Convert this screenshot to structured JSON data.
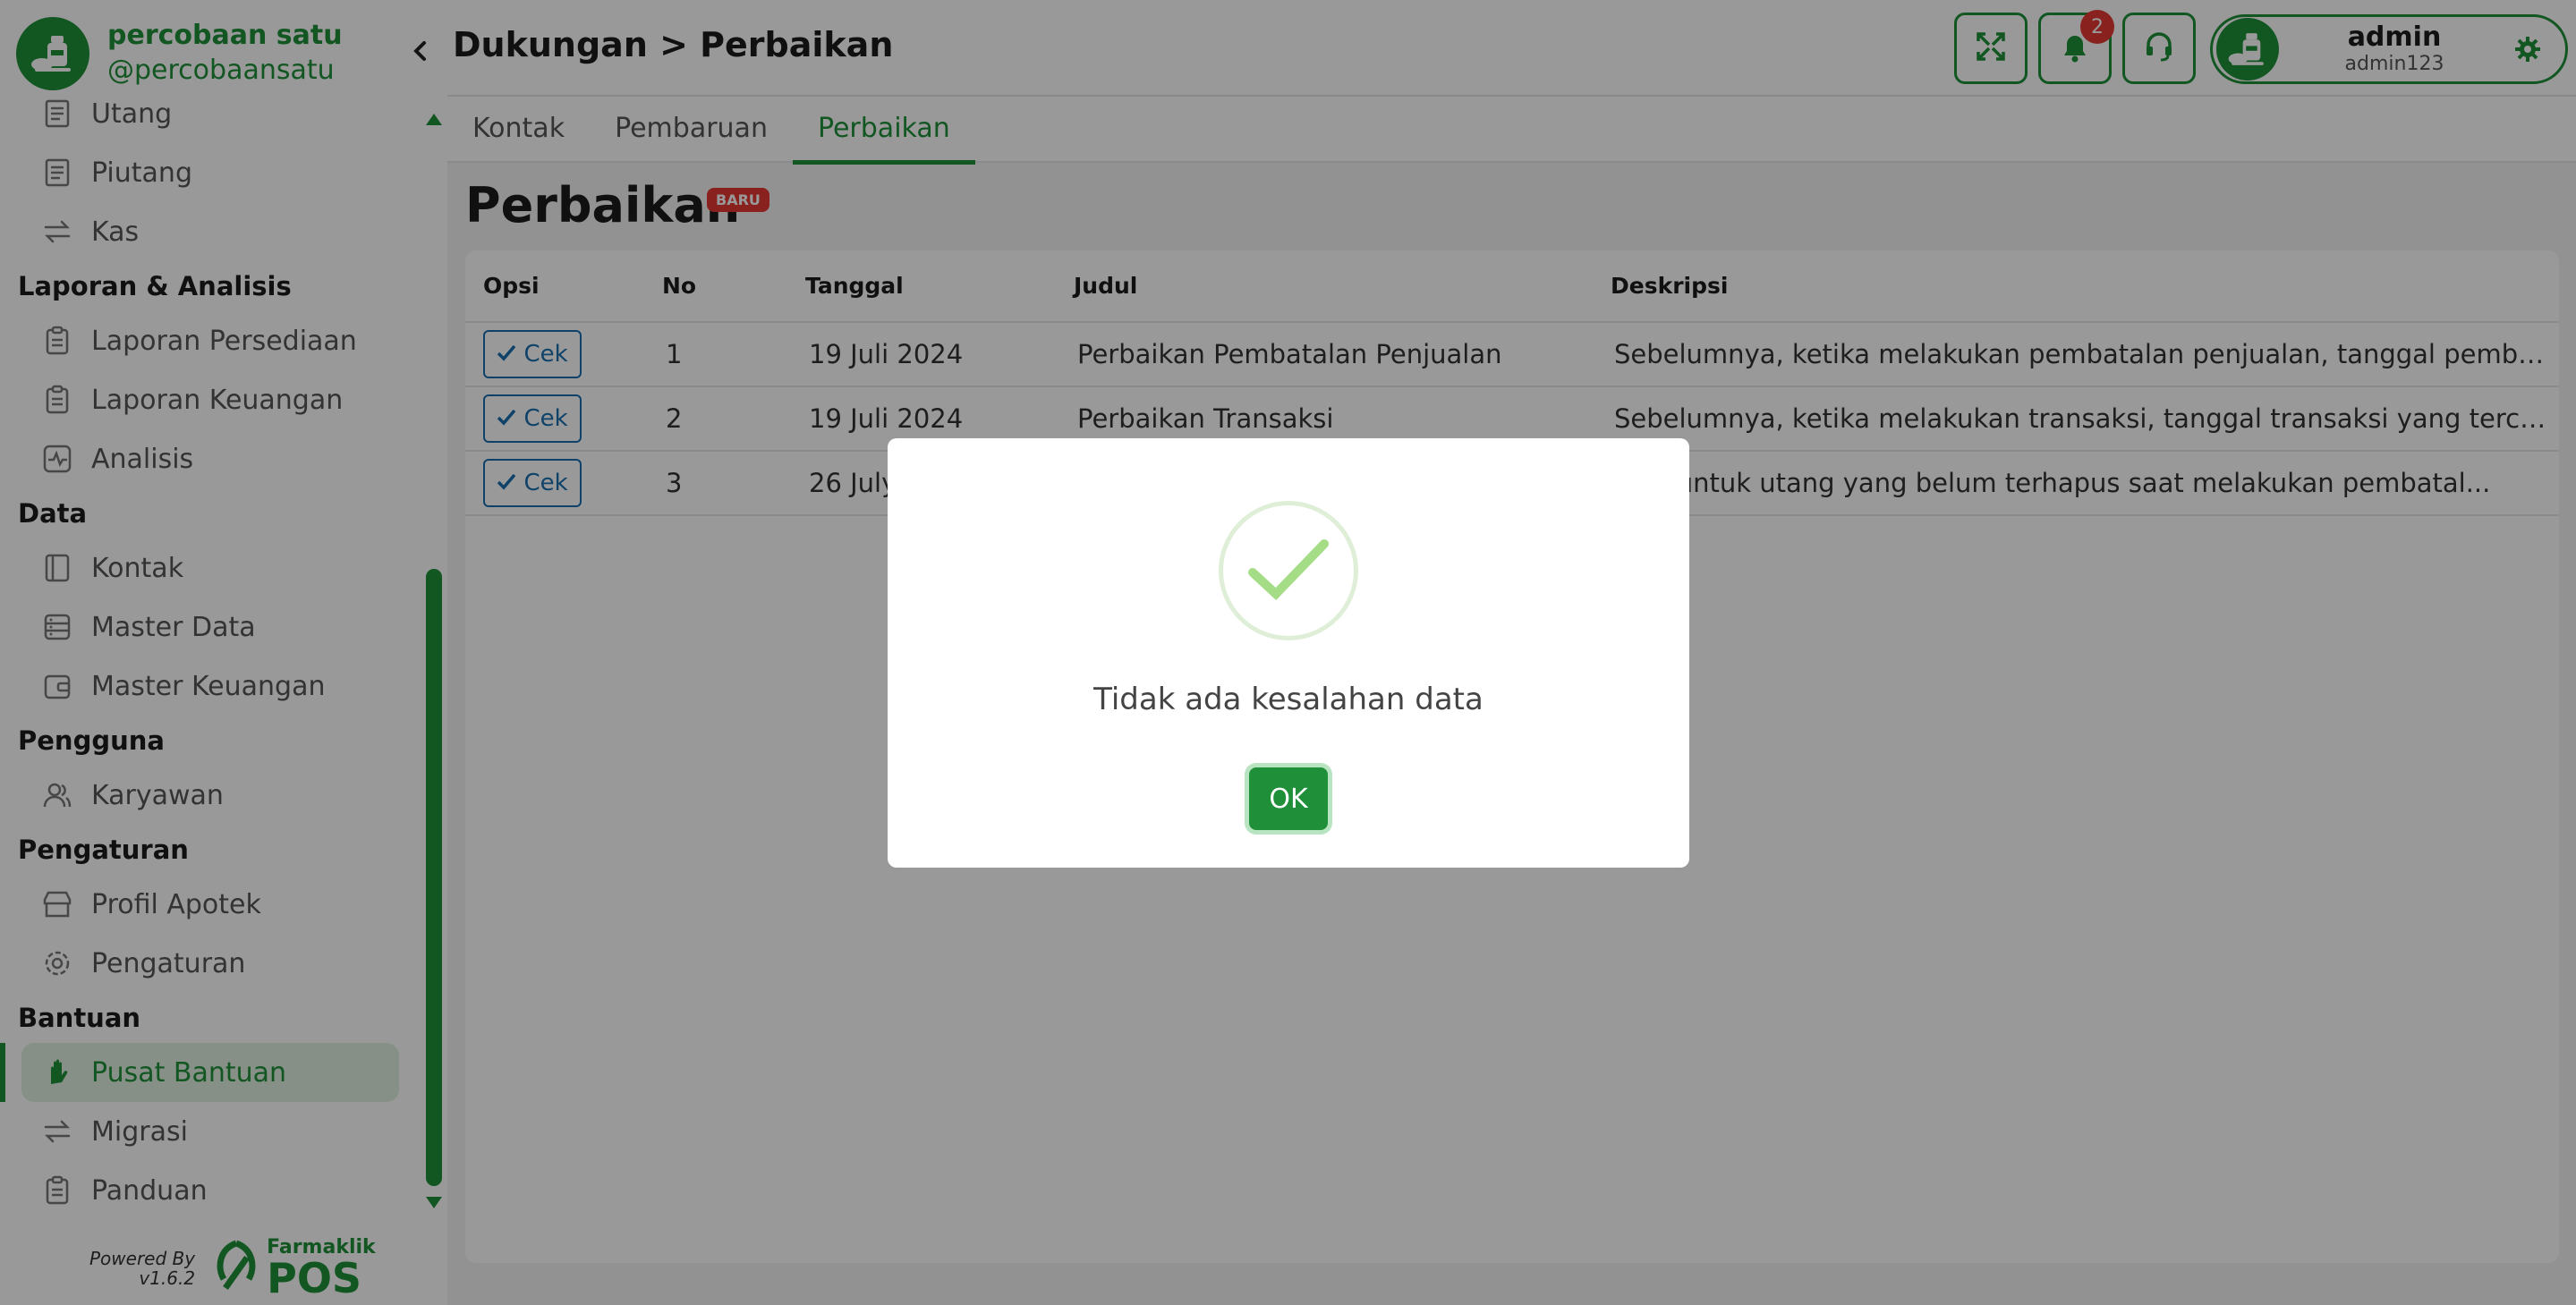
{
  "brand": {
    "name": "percobaan satu",
    "handle": "@percobaansatu"
  },
  "header": {
    "breadcrumb": "Dukungan > Perbaikan",
    "notification_count": "2"
  },
  "user": {
    "name": "admin",
    "id": "admin123"
  },
  "tabs": [
    {
      "label": "Kontak"
    },
    {
      "label": "Pembaruan"
    },
    {
      "label": "Perbaikan"
    }
  ],
  "sidebar": {
    "items_top": [
      {
        "label": "Utang",
        "icon": "receipt-icon"
      },
      {
        "label": "Piutang",
        "icon": "receipt-icon"
      },
      {
        "label": "Kas",
        "icon": "transfer-icon"
      }
    ],
    "sections": [
      {
        "title": "Laporan & Analisis",
        "items": [
          {
            "label": "Laporan Persediaan",
            "icon": "clipboard-icon"
          },
          {
            "label": "Laporan Keuangan",
            "icon": "clipboard-icon"
          },
          {
            "label": "Analisis",
            "icon": "pulse-icon"
          }
        ]
      },
      {
        "title": "Data",
        "items": [
          {
            "label": "Kontak",
            "icon": "contact-book-icon"
          },
          {
            "label": "Master Data",
            "icon": "database-icon"
          },
          {
            "label": "Master Keuangan",
            "icon": "wallet-icon"
          }
        ]
      },
      {
        "title": "Pengguna",
        "items": [
          {
            "label": "Karyawan",
            "icon": "users-icon"
          }
        ]
      },
      {
        "title": "Pengaturan",
        "items": [
          {
            "label": "Profil Apotek",
            "icon": "store-icon"
          },
          {
            "label": "Pengaturan",
            "icon": "gear-icon"
          }
        ]
      },
      {
        "title": "Bantuan",
        "items": [
          {
            "label": "Pusat Bantuan",
            "icon": "hand-icon",
            "active": true
          },
          {
            "label": "Migrasi",
            "icon": "transfer-icon"
          },
          {
            "label": "Panduan",
            "icon": "clipboard-icon"
          }
        ]
      }
    ]
  },
  "powered": {
    "text": "Powered By",
    "version": "v1.6.2",
    "logo_name": "Farmaklik",
    "logo_pos": "POS"
  },
  "page": {
    "title": "Perbaikan",
    "badge": "BARU"
  },
  "table": {
    "columns": [
      "Opsi",
      "No",
      "Tanggal",
      "Judul",
      "Deskripsi"
    ],
    "cek_label": "Cek",
    "rows": [
      {
        "no": "1",
        "tanggal": "19 Juli 2024",
        "judul": "Perbaikan Pembatalan Penjualan",
        "deskripsi": "Sebelumnya, ketika melakukan pembatalan penjualan, tanggal pembat..."
      },
      {
        "no": "2",
        "tanggal": "19 Juli 2024",
        "judul": "Perbaikan Transaksi",
        "deskripsi": "Sebelumnya, ketika melakukan transaksi, tanggal transaksi yang tercat..."
      },
      {
        "no": "3",
        "tanggal": "26 July",
        "judul": "",
        "deskripsi": "ikan untuk utang yang belum terhapus saat melakukan pembatal..."
      }
    ]
  },
  "modal": {
    "message": "Tidak ada kesalahan data",
    "ok_label": "OK"
  },
  "colors": {
    "primary": "#1f8f3a",
    "badge_red": "#e53935",
    "link_blue": "#1a6fb0"
  }
}
